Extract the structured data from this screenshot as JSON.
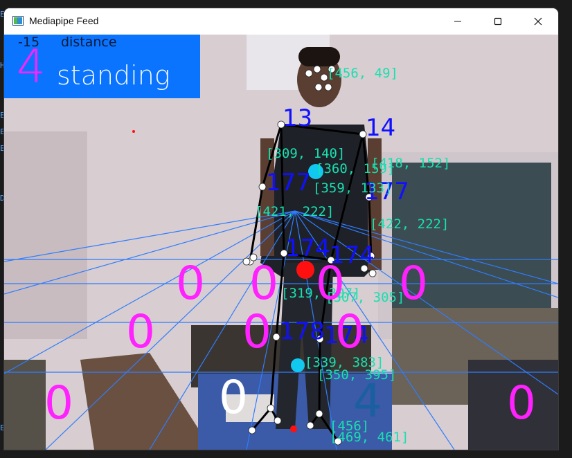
{
  "window": {
    "title": "Mediapipe Feed",
    "controls": {
      "minimize": "minimize",
      "maximize": "maximize",
      "close": "close"
    }
  },
  "overlay": {
    "distance_value": "-15",
    "distance_label": "distance",
    "count": "4",
    "pose_label": "standing"
  },
  "angles": [
    "13",
    "14",
    "177",
    "177",
    "174",
    "174",
    "178",
    "174"
  ],
  "coords": [
    "[456, 49]",
    "[309, 140]",
    "[360, 159]",
    "[418, 152]",
    "[359, 133]",
    "[421, 222]",
    "[422, 222]",
    "[319, 307]",
    "[307, 305]",
    "[339, 383]",
    "[350, 395]",
    "[456]",
    "[469, 461]"
  ],
  "floor_zeros": [
    "0",
    "0",
    "0",
    "0",
    "0",
    "0",
    "0",
    "0",
    "0",
    "0"
  ],
  "floor_four": "4",
  "colors": {
    "info_panel": "#0a74ff",
    "count": "#ff22ff",
    "angles": "#1010ff",
    "coords": "#18e0b0",
    "zeros": "#ff22ff",
    "grid_lines": "#2f7dff",
    "cyan_marker": "#10c8f0",
    "red_marker": "#ff1010"
  }
}
